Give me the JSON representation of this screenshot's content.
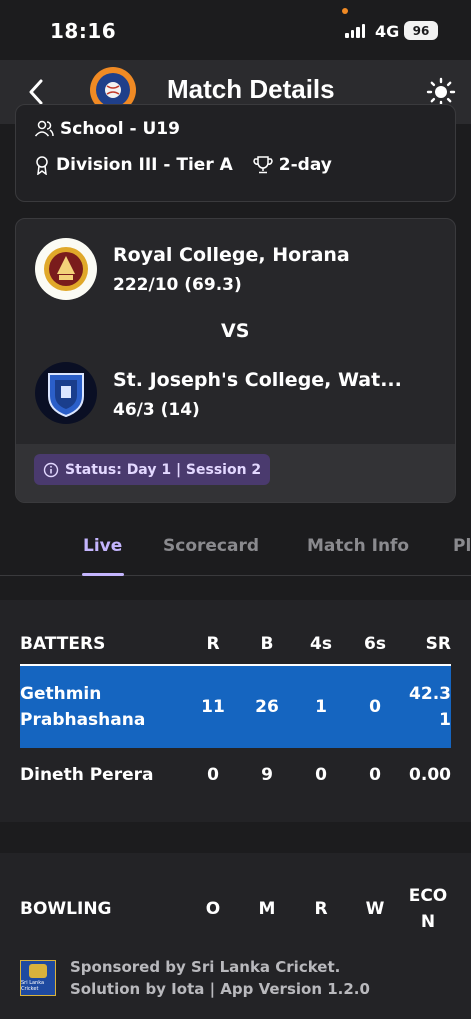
{
  "status_bar": {
    "time": "18:16",
    "network": "4G",
    "battery": "96"
  },
  "header": {
    "title": "Match Details"
  },
  "match_info": {
    "category": "School - U19",
    "division": "Division III - Tier A",
    "format": "2-day"
  },
  "teams": [
    {
      "name": "Royal College, Horana",
      "score": "222/10 (69.3)"
    },
    {
      "name": "St. Joseph's College, Wat...",
      "score": "46/3 (14)"
    }
  ],
  "vs_label": "VS",
  "match_status": "Status: Day 1 | Session 2",
  "tabs": [
    {
      "label": "Live",
      "active": true
    },
    {
      "label": "Scorecard"
    },
    {
      "label": "Match Info"
    },
    {
      "label": "Pl"
    }
  ],
  "batting": {
    "headers": [
      "BATTERS",
      "R",
      "B",
      "4s",
      "6s",
      "SR"
    ],
    "rows": [
      {
        "name": "Gethmin Prabhashana",
        "r": "11",
        "b": "26",
        "fours": "1",
        "sixes": "0",
        "sr": "42.31",
        "highlighted": true
      },
      {
        "name": "Dineth Perera",
        "r": "0",
        "b": "9",
        "fours": "0",
        "sixes": "0",
        "sr": "0.00"
      }
    ]
  },
  "bowling": {
    "headers": [
      "BOWLING",
      "O",
      "M",
      "R",
      "W",
      "ECON"
    ]
  },
  "footer": {
    "line1": "Sponsored by Sri Lanka Cricket.",
    "line2": "Solution by Iota | App Version 1.2.0",
    "logo_text": "Sri Lanka Cricket"
  },
  "colors": {
    "accent": "#c4b5fd",
    "highlight_row": "#1565c0",
    "status_pill": "#4a3a6e",
    "brand_orange": "#f08a24"
  }
}
